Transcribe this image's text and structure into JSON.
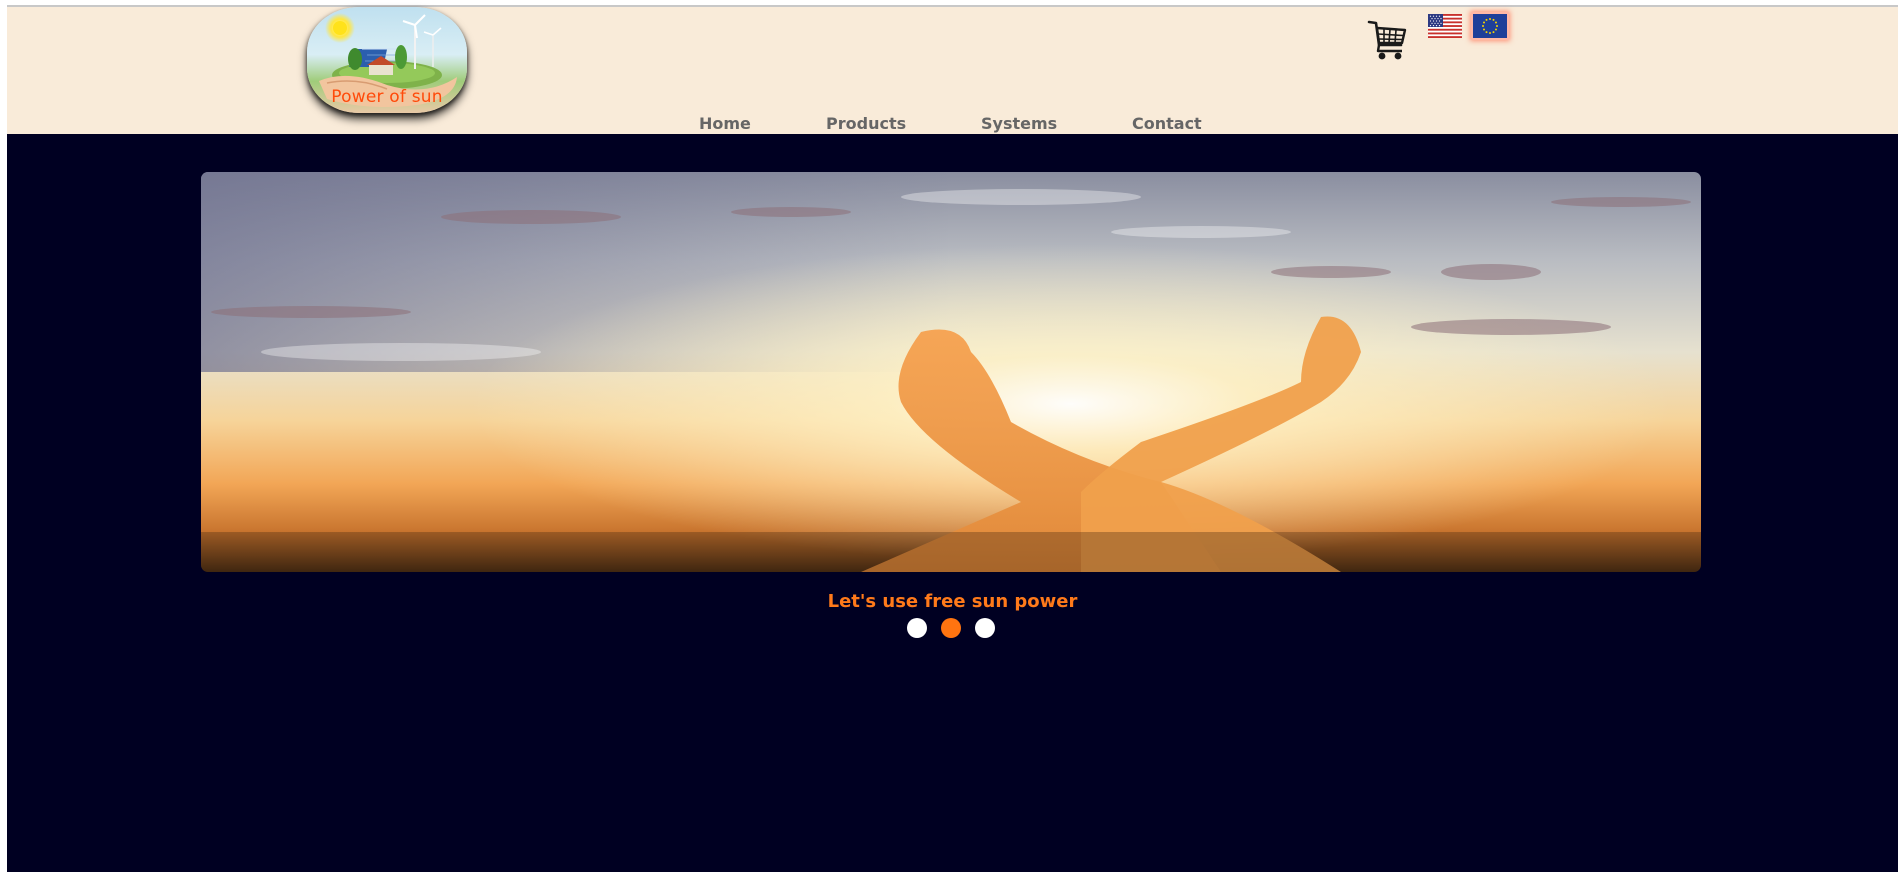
{
  "logo": {
    "text": "Power of sun"
  },
  "nav": {
    "items": [
      {
        "label": "Home"
      },
      {
        "label": "Products"
      },
      {
        "label": "Systems"
      },
      {
        "label": "Contact"
      }
    ]
  },
  "header": {
    "cart_icon": "shopping-cart-icon",
    "languages": [
      {
        "flag": "us-flag-icon",
        "active": false
      },
      {
        "flag": "eu-flag-icon",
        "active": true
      }
    ]
  },
  "slider": {
    "caption": "Let's use free sun power",
    "slide_count": 3,
    "active_slide": 2
  },
  "colors": {
    "header_bg": "#f9ebd9",
    "page_bg": "#000022",
    "nav_text": "#666666",
    "accent": "#ff7410",
    "logo_text": "#ff4a0a"
  }
}
